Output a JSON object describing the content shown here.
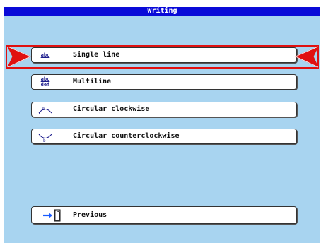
{
  "window": {
    "title": "Writing"
  },
  "menu": {
    "items": [
      {
        "label": "Single line",
        "icon": "abc-single-line-icon"
      },
      {
        "label": "Multiline",
        "icon": "abc-def-multiline-icon"
      },
      {
        "label": "Circular clockwise",
        "icon": "circular-clockwise-icon"
      },
      {
        "label": "Circular counterclockwise",
        "icon": "circular-counterclockwise-icon"
      }
    ],
    "selected_label": "Single line"
  },
  "footer": {
    "previous_label": "Previous",
    "icon": "exit-door-icon"
  },
  "icons": {
    "abc": "abc",
    "abc_top": "abc",
    "abc_bottom": "def"
  },
  "colors": {
    "titlebar": "#0a0ad8",
    "background": "#a8d4f0",
    "selection": "#e01010",
    "arrow_blue": "#1a5cff"
  }
}
